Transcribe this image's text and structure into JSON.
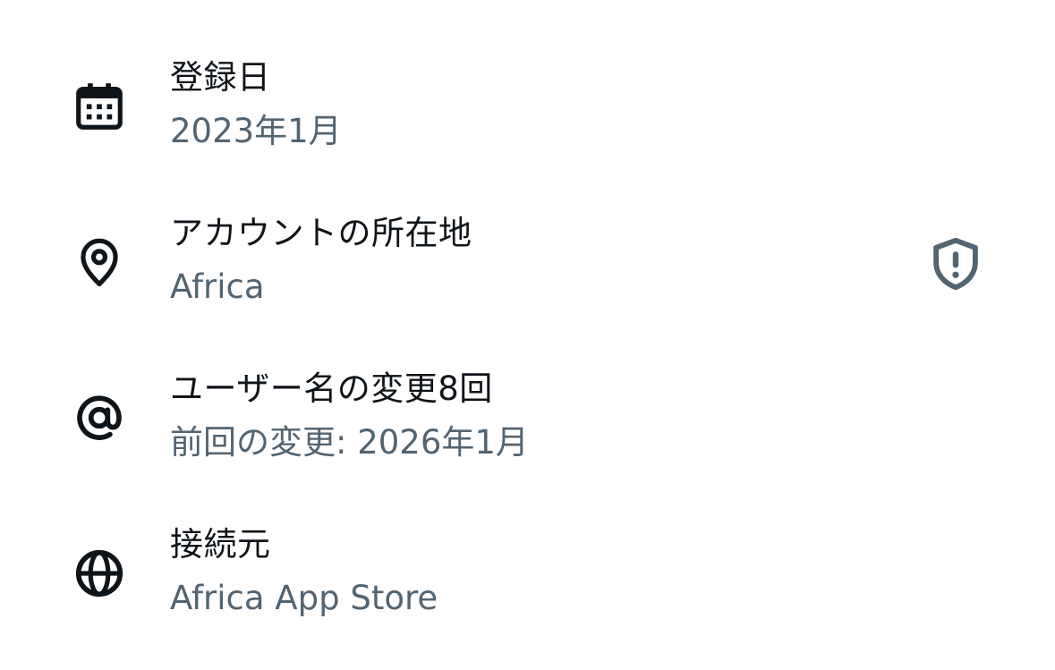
{
  "rows": [
    {
      "icon": "calendar-icon",
      "title": "登録日",
      "subtitle": "2023年1月"
    },
    {
      "icon": "location-pin-icon",
      "title": "アカウントの所在地",
      "subtitle": "Africa",
      "action_icon": "shield-alert-icon"
    },
    {
      "icon": "at-sign-icon",
      "title": "ユーザー名の変更8回",
      "subtitle": "前回の変更: 2026年1月"
    },
    {
      "icon": "globe-icon",
      "title": "接続元",
      "subtitle": "Africa App Store"
    }
  ],
  "colors": {
    "primary_text": "#0f1419",
    "secondary_text": "#536471",
    "background": "#ffffff",
    "shield_icon": "#536471"
  }
}
